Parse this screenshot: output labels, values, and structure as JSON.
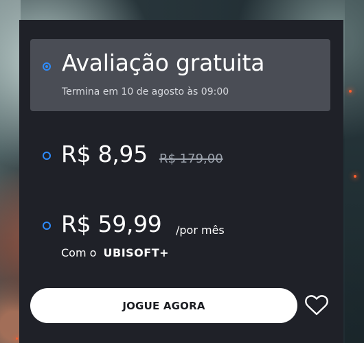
{
  "offers": {
    "trial": {
      "title": "Avaliação gratuita",
      "subtitle": "Termina em 10 de agosto às 09:00"
    },
    "purchase": {
      "price": "R$ 8,95",
      "original_price": "R$ 179,00"
    },
    "subscription": {
      "price": "R$ 59,99",
      "period": "/por mês",
      "prefix": "Com o",
      "service": "UBISOFT+"
    }
  },
  "actions": {
    "play_label": "JOGUE AGORA",
    "wishlist_icon": "heart-icon"
  },
  "theme": {
    "panel_background": "#1f2128",
    "selected_background": "#4a4d55",
    "accent": "#2d8cff",
    "primary_text": "#ffffff",
    "muted_text": "#9ca3ad",
    "button_background": "#ffffff",
    "button_text": "#1b1d22"
  },
  "state": {
    "selected_option": "trial"
  }
}
